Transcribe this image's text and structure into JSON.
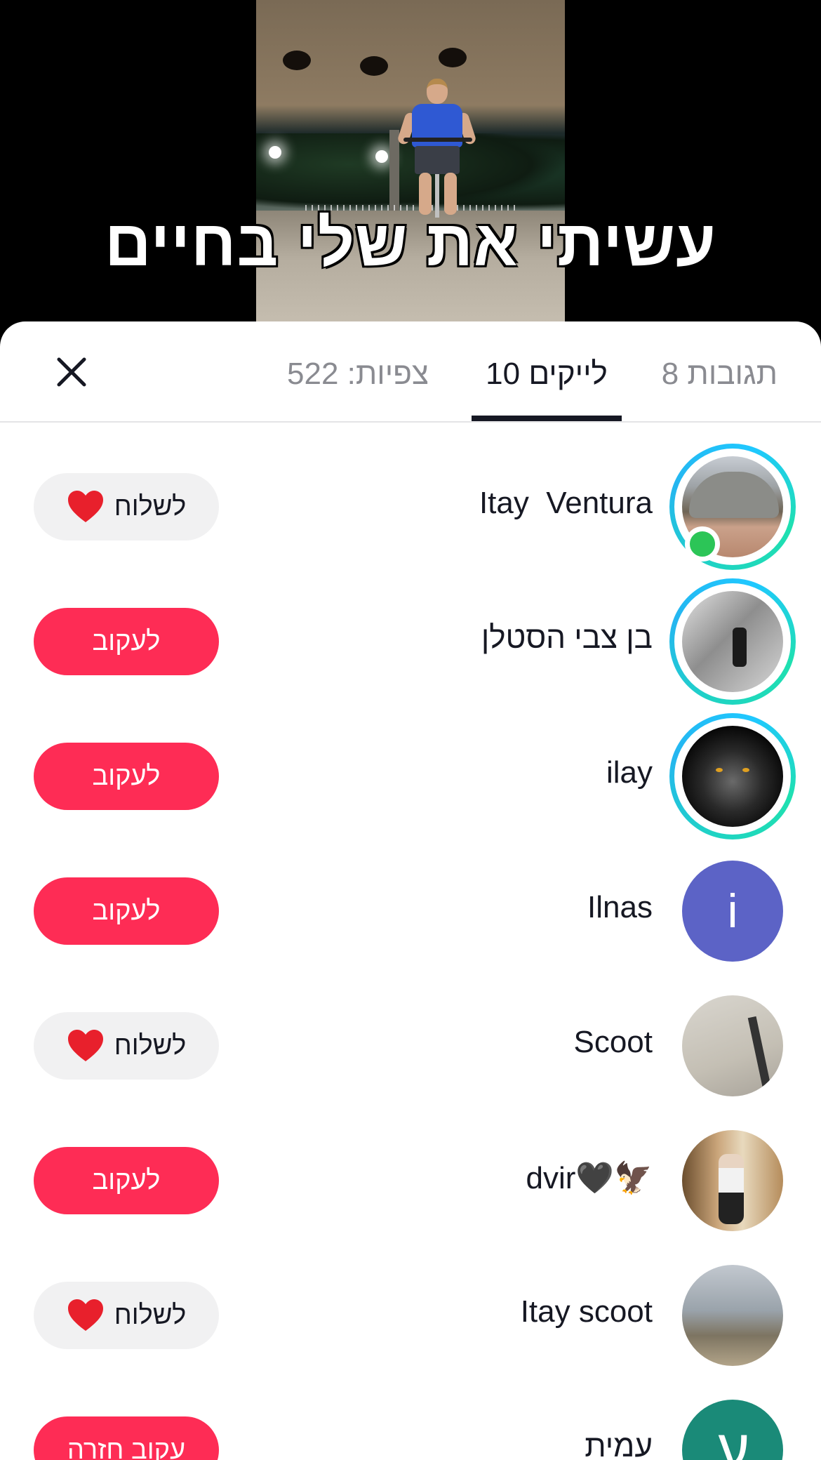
{
  "video": {
    "caption": "עשיתי את שלי בחיים"
  },
  "tabs": {
    "comments": "תגובות 8",
    "likes": "לייקים 10",
    "views": "צפיות: 522"
  },
  "likers": [
    {
      "name": "Itay  Ventura",
      "button": "לשלוח",
      "button_type": "send",
      "story_ring": true,
      "online": true
    },
    {
      "name": "בן צבי הסטלן",
      "button": "לעקוב",
      "button_type": "follow",
      "story_ring": true,
      "online": false
    },
    {
      "name": "ilay",
      "button": "לעקוב",
      "button_type": "follow",
      "story_ring": true,
      "online": false
    },
    {
      "name": "Ilnas",
      "avatar_letter": "i",
      "button": "לעקוב",
      "button_type": "follow",
      "story_ring": false,
      "online": false
    },
    {
      "name": "Scoot",
      "button": "לשלוח",
      "button_type": "send",
      "story_ring": false,
      "online": false
    },
    {
      "name": "dvir🖤🦅",
      "button": "לעקוב",
      "button_type": "follow",
      "story_ring": false,
      "online": false
    },
    {
      "name": "Itay scoot",
      "button": "לשלוח",
      "button_type": "send",
      "story_ring": false,
      "online": false
    },
    {
      "name": "עמית",
      "avatar_letter": "ע",
      "button": "עקוב חזרה",
      "button_type": "follow",
      "story_ring": false,
      "online": false
    }
  ],
  "colors": {
    "follow_button": "#fe2c55",
    "send_button": "#f1f1f2",
    "online_dot": "#2cc557"
  }
}
